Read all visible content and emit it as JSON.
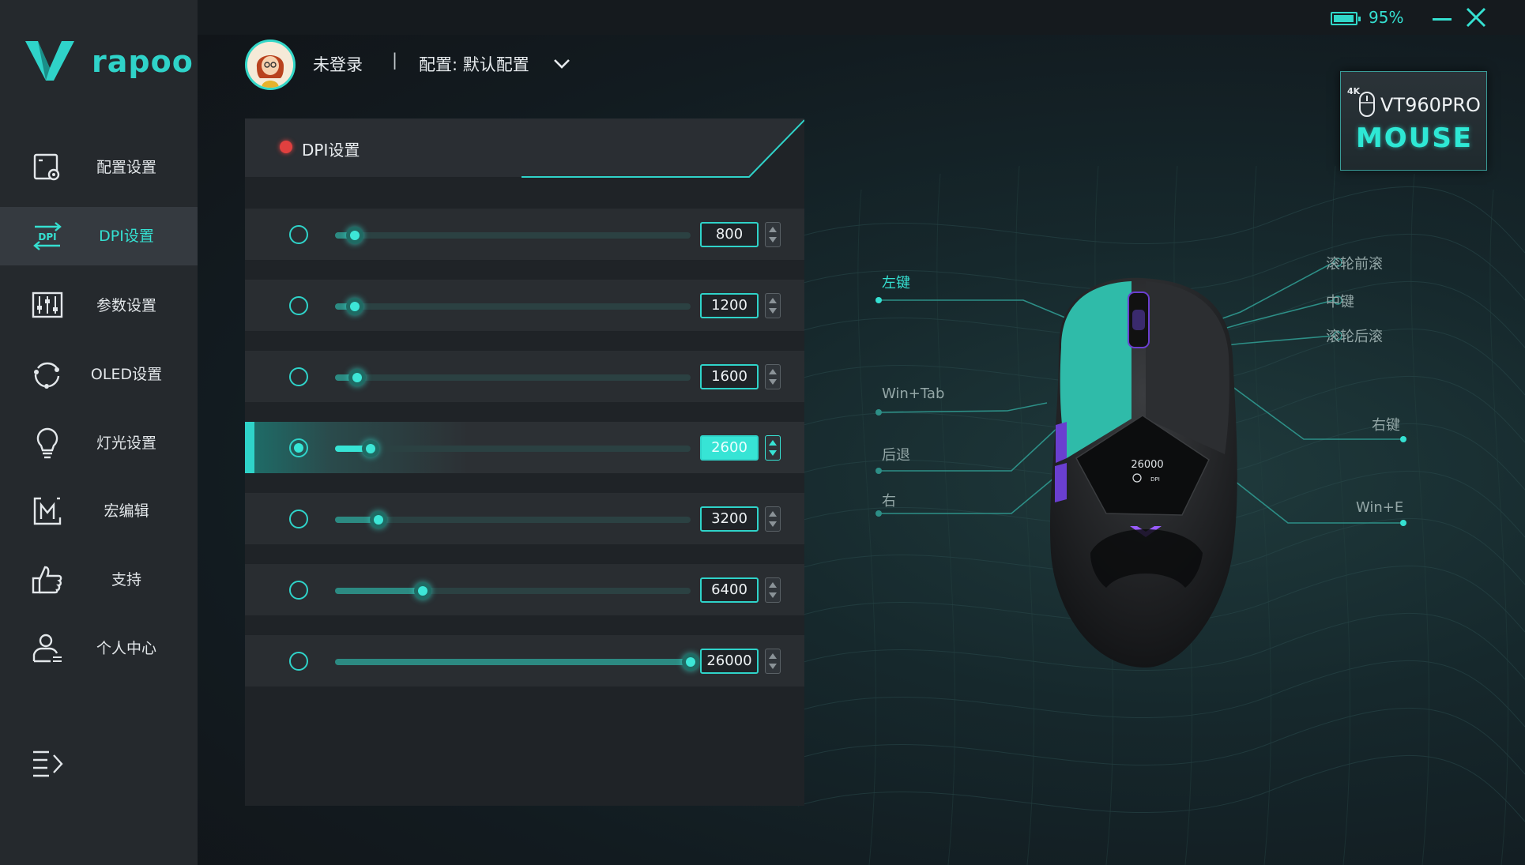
{
  "app": {
    "brand": "rapoo"
  },
  "titlebar": {
    "battery_percent": 95,
    "battery_text": "95%",
    "accent_color": "#35e0d1"
  },
  "sidebar": {
    "items": [
      {
        "label": "配置设置",
        "icon": "config-settings-icon",
        "active": false
      },
      {
        "label": "DPI设置",
        "icon": "dpi-icon",
        "active": true
      },
      {
        "label": "参数设置",
        "icon": "sliders-icon",
        "active": false
      },
      {
        "label": "OLED设置",
        "icon": "refresh-cycle-icon",
        "active": false
      },
      {
        "label": "灯光设置",
        "icon": "lightbulb-icon",
        "active": false
      },
      {
        "label": "宏编辑",
        "icon": "macro-icon",
        "active": false
      },
      {
        "label": "支持",
        "icon": "thumbs-up-icon",
        "active": false
      },
      {
        "label": "个人中心",
        "icon": "user-icon",
        "active": false
      }
    ]
  },
  "header": {
    "user_name": "未登录",
    "separator": "|",
    "config_label": "配置: 默认配置"
  },
  "dpi_panel": {
    "title": "DPI设置",
    "max_dpi": 26000,
    "levels": [
      {
        "value": "800",
        "dpi": 800,
        "selected": false
      },
      {
        "value": "1200",
        "dpi": 1200,
        "selected": false
      },
      {
        "value": "1600",
        "dpi": 1600,
        "selected": false
      },
      {
        "value": "2600",
        "dpi": 2600,
        "selected": true
      },
      {
        "value": "3200",
        "dpi": 3200,
        "selected": false
      },
      {
        "value": "6400",
        "dpi": 6400,
        "selected": false
      },
      {
        "value": "26000",
        "dpi": 26000,
        "selected": false
      }
    ]
  },
  "device": {
    "badge_4k": "4K",
    "model_name": "VT960PRO",
    "model_type": "MOUSE",
    "oled_value": "26000",
    "oled_unit": "DPI"
  },
  "mouse_buttons": {
    "left": "左键",
    "win_tab": "Win+Tab",
    "back": "后退",
    "right_side": "右",
    "wheel_forward": "滚轮前滚",
    "middle": "中键",
    "wheel_back": "滚轮后滚",
    "right": "右键",
    "win_e": "Win+E"
  }
}
